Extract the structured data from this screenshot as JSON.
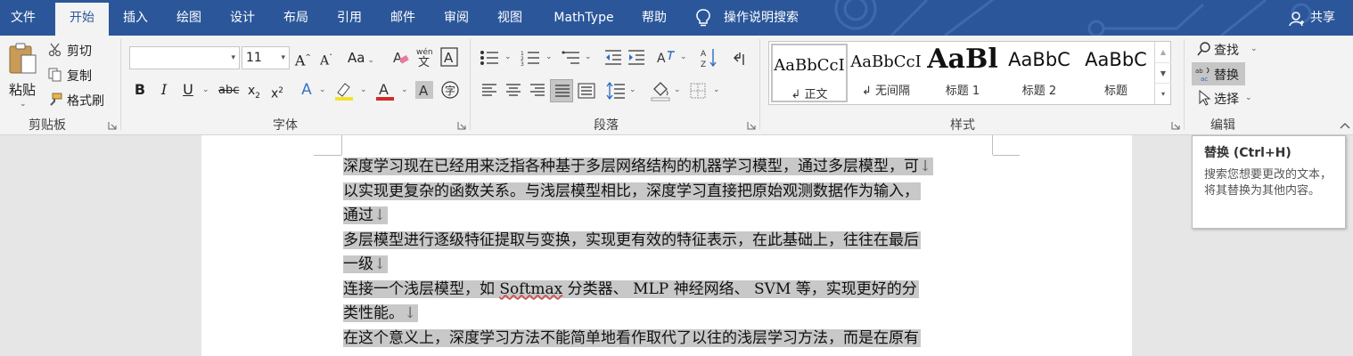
{
  "tabs": [
    "文件",
    "开始",
    "插入",
    "绘图",
    "设计",
    "布局",
    "引用",
    "邮件",
    "审阅",
    "视图",
    "MathType",
    "帮助"
  ],
  "active_tab": "开始",
  "tell_me": "操作说明搜索",
  "share": "共享",
  "clipboard": {
    "paste": "粘贴",
    "cut": "剪切",
    "copy": "复制",
    "format_painter": "格式刷",
    "label": "剪贴板"
  },
  "font": {
    "font_name": "",
    "font_size": "11",
    "case_label": "Aa",
    "label": "字体"
  },
  "paragraph": {
    "label": "段落"
  },
  "styles": {
    "label": "样式",
    "items": [
      {
        "sample": "AaBbCcI",
        "name": "↲ 正文"
      },
      {
        "sample": "AaBbCcI",
        "name": "↲ 无间隔"
      },
      {
        "sample": "AaBl",
        "name": "标题 1"
      },
      {
        "sample": "AaBbC",
        "name": "标题 2"
      },
      {
        "sample": "AaBbC",
        "name": "标题"
      }
    ]
  },
  "editing": {
    "find": "查找",
    "replace": "替换",
    "select": "选择",
    "label": "编辑"
  },
  "tooltip": {
    "title": "替换 (Ctrl+H)",
    "description": "搜索您想要更改的文本，将其替换为其他内容。"
  },
  "document": {
    "lines": [
      "深度学习现在已经用来泛指各种基于多层网络结构的机器学习模型，通过多层模型，可",
      "以实现更复杂的函数关系。与浅层模型相比，深度学习直接把原始观测数据作为输入，",
      "通过",
      "多层模型进行逐级特征提取与变换，实现更有效的特征表示，在此基础上，往往在最后",
      "一级",
      "连接一个浅层模型，如 ",
      "类性能。",
      "在这个意义上，深度学习方法不能简单地看作取代了以往的浅层学习方法，而是在原有"
    ],
    "line6_softmax": "Softmax",
    "line6_rest": " 分类器、 MLP 神经网络、 SVM 等，实现更好的分",
    "paragraph_mark": "↓"
  }
}
